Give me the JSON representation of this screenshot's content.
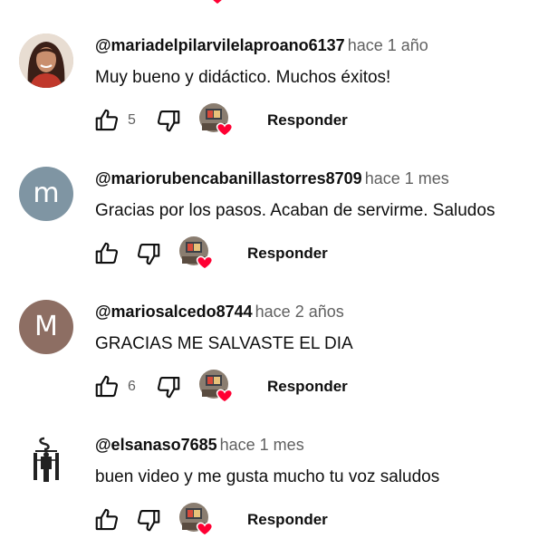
{
  "comments": [
    {
      "author": "@mariadelpilarvilelaproano6137",
      "time": "hace 1 año",
      "text": "Muy bueno y didáctico. Muchos éxitos!",
      "likes": "5",
      "avatar_type": "photo",
      "reply_label": "Responder"
    },
    {
      "author": "@mariorubencabanillastorres8709",
      "time": "hace 1 mes",
      "text": "Gracias por los pasos. Acaban de servirme. Saludos",
      "likes": "",
      "avatar_type": "letter",
      "avatar_letter": "m",
      "avatar_color": "#7f95a3",
      "reply_label": "Responder"
    },
    {
      "author": "@mariosalcedo8744",
      "time": "hace 2 años",
      "text": "GRACIAS ME SALVASTE EL DIA",
      "likes": "6",
      "avatar_type": "letter",
      "avatar_letter": "M",
      "avatar_color": "#8d6e63",
      "reply_label": "Responder"
    },
    {
      "author": "@elsanaso7685",
      "time": "hace 1 mes",
      "text": "buen video y me gusta mucho tu voz saludos",
      "likes": "",
      "avatar_type": "logo",
      "reply_label": "Responder"
    }
  ],
  "icons": {
    "like": "thumbs-up-icon",
    "dislike": "thumbs-down-icon",
    "creator_heart": "creator-heart-icon"
  },
  "colors": {
    "heart": "#ff0033",
    "secondary_text": "#606060",
    "primary_text": "#0f0f0f"
  }
}
